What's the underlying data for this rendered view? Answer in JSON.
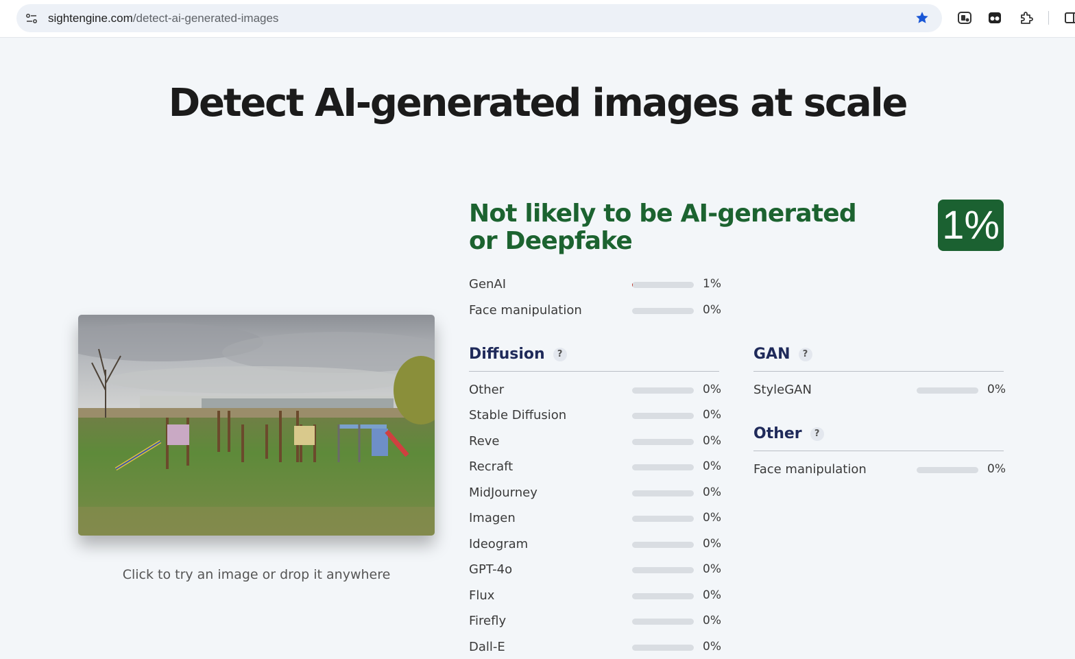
{
  "browser": {
    "url_host": "sightengine.com",
    "url_path": "/detect-ai-generated-images",
    "icons": [
      "site-info-icon",
      "bookmark-star-icon",
      "extension-puzzle-icon"
    ]
  },
  "page": {
    "title": "Detect AI-generated images at scale",
    "caption": "Click to try an image or drop it anywhere",
    "verdict": "Not likely to be AI-generated or Deepfake",
    "score": "1%",
    "accent_color": "#1b6131"
  },
  "summary": [
    {
      "label": "GenAI",
      "value": 1,
      "text": "1%"
    },
    {
      "label": "Face manipulation",
      "value": 0,
      "text": "0%"
    }
  ],
  "diffusion": {
    "title": "Diffusion",
    "help": "?",
    "items": [
      {
        "label": "Other",
        "value": 0,
        "text": "0%"
      },
      {
        "label": "Stable Diffusion",
        "value": 0,
        "text": "0%"
      },
      {
        "label": "Reve",
        "value": 0,
        "text": "0%"
      },
      {
        "label": "Recraft",
        "value": 0,
        "text": "0%"
      },
      {
        "label": "MidJourney",
        "value": 0,
        "text": "0%"
      },
      {
        "label": "Imagen",
        "value": 0,
        "text": "0%"
      },
      {
        "label": "Ideogram",
        "value": 0,
        "text": "0%"
      },
      {
        "label": "GPT-4o",
        "value": 0,
        "text": "0%"
      },
      {
        "label": "Flux",
        "value": 0,
        "text": "0%"
      },
      {
        "label": "Firefly",
        "value": 0,
        "text": "0%"
      },
      {
        "label": "Dall-E",
        "value": 0,
        "text": "0%"
      }
    ]
  },
  "gan": {
    "title": "GAN",
    "help": "?",
    "items": [
      {
        "label": "StyleGAN",
        "value": 0,
        "text": "0%"
      }
    ]
  },
  "other": {
    "title": "Other",
    "help": "?",
    "items": [
      {
        "label": "Face manipulation",
        "value": 0,
        "text": "0%"
      }
    ]
  }
}
